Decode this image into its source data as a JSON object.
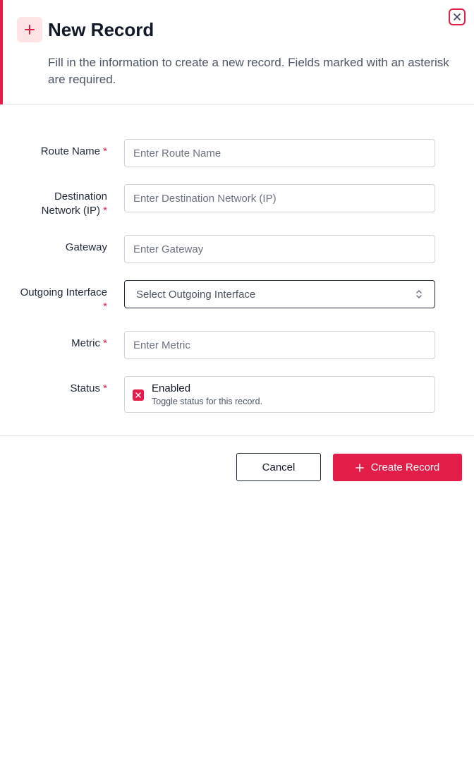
{
  "dialog": {
    "title": "New Record",
    "subtitle": "Fill in the information to create a new record. Fields marked with an asterisk are required.",
    "accent_color": "#e11d48",
    "header_icon": "plus-icon",
    "close_icon": "close-icon"
  },
  "form": {
    "required_marker": "*",
    "route_name": {
      "label": "Route Name",
      "placeholder": "Enter Route Name",
      "value": ""
    },
    "destination_network": {
      "label_line1": "Destination",
      "label_line2": "Network (IP)",
      "placeholder": "Enter Destination Network (IP)",
      "value": ""
    },
    "gateway": {
      "label": "Gateway",
      "placeholder": "Enter Gateway",
      "value": ""
    },
    "outgoing_interface": {
      "label": "Outgoing Interface",
      "selected": "Select Outgoing Interface",
      "icon": "chevron-up-down-icon"
    },
    "metric": {
      "label": "Metric",
      "placeholder": "Enter Metric",
      "value": ""
    },
    "status": {
      "label": "Status",
      "title": "Enabled",
      "description": "Toggle status for this record.",
      "toggle_icon": "x-icon"
    }
  },
  "footer": {
    "cancel_label": "Cancel",
    "create_label": "Create Record",
    "create_icon": "plus-icon"
  }
}
